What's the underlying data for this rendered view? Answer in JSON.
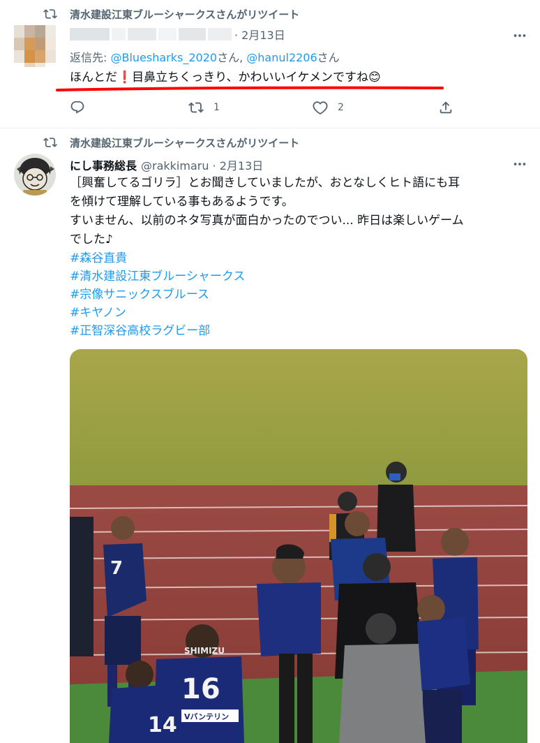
{
  "tweet1": {
    "retweet_label": "清水建設江東ブルーシャークスさんがリツイート",
    "date": "· 2月13日",
    "reply_prefix": "返信先: ",
    "mention1": "@Bluesharks_2020",
    "mention_suffix1": "さん, ",
    "mention2": "@hanul2206",
    "mention_suffix2": "さん",
    "text_part1": "ほんとだ",
    "exclaim_emoji": "❗",
    "text_part2": "目鼻立ちくっきり、かわいいイケメンですね",
    "smile_emoji": "😊",
    "retweet_count": "1",
    "like_count": "2"
  },
  "tweet2": {
    "retweet_label": "清水建設江東ブルーシャークスさんがリツイート",
    "display_name": "にし事務総長",
    "handle_date": "@rakkimaru · 2月13日",
    "text_line1": "［興奮してるゴリラ］とお聞きしていましたが、おとなしくヒト語にも耳",
    "text_line2": "を傾けて理解している事もあるようです。",
    "text_line3": "すいません、以前のネタ写真が面白かったのでつい... 昨日は楽しいゲーム",
    "text_line4": "でした♪",
    "hashtags": [
      "#森谷直貴",
      "#清水建設江東ブルーシャークス",
      "#宗像サニックスブルース",
      "#キヤノン",
      "#正智深谷高校ラグビー部"
    ],
    "photo_jersey_number_front": "16",
    "photo_jersey_number_side": "7",
    "photo_jersey_number_partial": "14",
    "photo_jersey_team": "SHIMIZU",
    "photo_sponsor": "Vバンテリン"
  },
  "colors": {
    "accent": "#1d9bf0",
    "muted": "#536471",
    "highlight_underline": "#ff0000"
  },
  "icons": [
    "retweet-icon",
    "more-icon",
    "reply-icon",
    "like-icon",
    "share-icon"
  ]
}
